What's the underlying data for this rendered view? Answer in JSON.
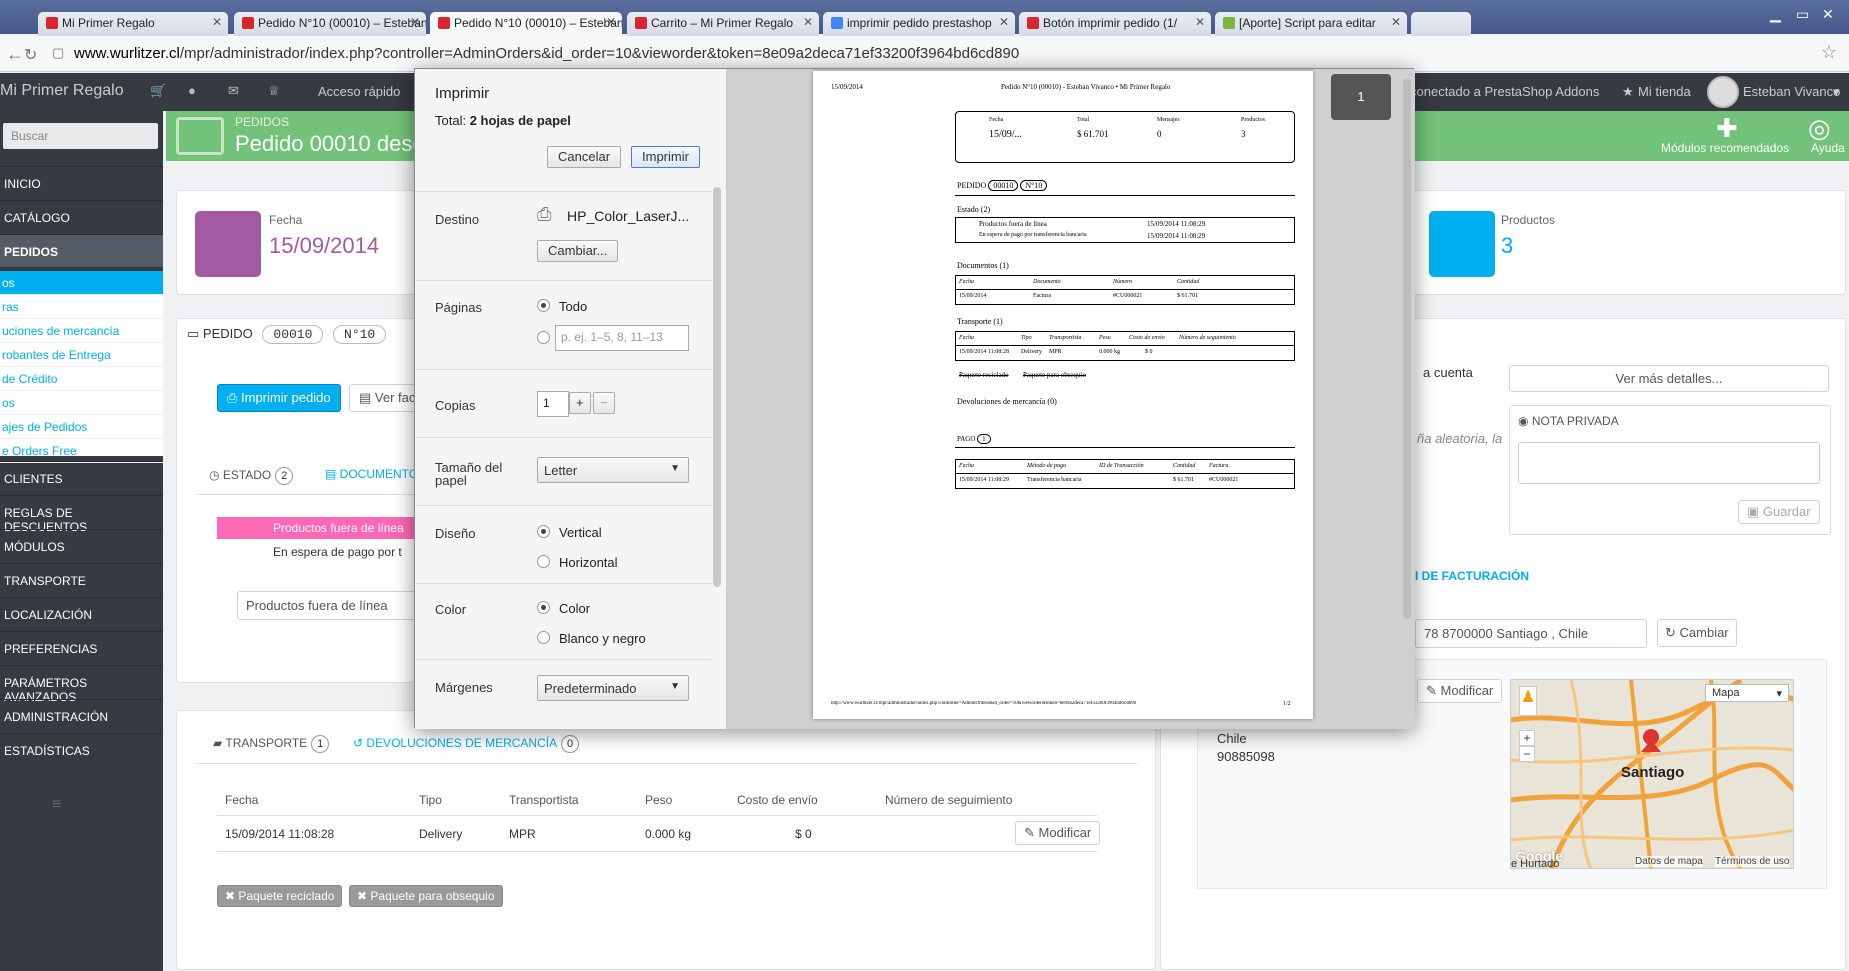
{
  "browser": {
    "tabs": [
      {
        "title": "Mi Primer Regalo"
      },
      {
        "title": "Pedido N°10 (00010) – Esteban"
      },
      {
        "title": "Pedido N°10 (00010) – Esteban"
      },
      {
        "title": "Carrito – Mi Primer Regalo"
      },
      {
        "title": "imprimir pedido prestashop"
      },
      {
        "title": "Botón imprimir pedido (1/"
      },
      {
        "title": "[Aporte] Script para editar"
      }
    ],
    "url_host": "www.wurlitzer.cl",
    "url_path": "/mpr/administrador/index.php?controller=AdminOrders&id_order=10&vieworder&token=8e09a2deca71ef33200f3964bd6cd890"
  },
  "topbar": {
    "brand": "Mi Primer Regalo",
    "quick_access": "Acceso rápido",
    "addons": "conectado a PrestaShop Addons",
    "shop": "Mi tienda",
    "user": "Esteban Vivanco"
  },
  "header": {
    "breadcrumb": "PEDIDOS",
    "title": "Pedido 00010 desde",
    "modules_btn": "Módulos recomendados",
    "help_btn": "Ayuda"
  },
  "sidebar": {
    "search_placeholder": "Buscar",
    "items": [
      "INICIO",
      "CATÁLOGO",
      "PEDIDOS",
      "CLIENTES",
      "REGLAS DE DESCUENTOS",
      "MÓDULOS",
      "TRANSPORTE",
      "LOCALIZACIÓN",
      "PREFERENCIAS",
      "PARÁMETROS AVANZADOS",
      "ADMINISTRACIÓN",
      "ESTADÍSTICAS"
    ],
    "submenu": [
      "os",
      "ras",
      "uciones de mercancía",
      "robantes de Entrega",
      "de Crédito",
      "os",
      "ajes de Pedidos",
      "e Orders Free"
    ]
  },
  "kpis": {
    "date_label": "Fecha",
    "date_value": "15/09/2014",
    "products_label": "Productos",
    "products_value": "3"
  },
  "order": {
    "label": "PEDIDO",
    "ref": "00010",
    "num": "N°10",
    "print_btn": "Imprimir pedido",
    "view_btn": "Ver fact",
    "tab_status": "ESTADO",
    "tab_status_count": "2",
    "tab_docs": "DOCUMENTOS",
    "status_rows": [
      "Productos fuera de línea",
      "En espera de pago por t"
    ],
    "status_select": "Productos fuera de línea"
  },
  "transport": {
    "tab": "TRANSPORTE",
    "tab_count": "1",
    "returns_tab": "DEVOLUCIONES DE MERCANCÍA",
    "returns_count": "0",
    "headers": [
      "Fecha",
      "Tipo",
      "Transportista",
      "Peso",
      "Costo de envío",
      "Número de seguimiento"
    ],
    "row": [
      "15/09/2014 11:08:28",
      "Delivery",
      "MPR",
      "0.000 kg",
      "$ 0"
    ],
    "edit_btn": "Modificar",
    "recycled_btn": "Paquete reciclado",
    "gift_btn": "Paquete para obsequio"
  },
  "customer": {
    "account_frag": "a cuenta",
    "random_frag": "ña aleatoria, la",
    "details_btn": "Ver más detalles...",
    "private_note": "NOTA PRIVADA",
    "save_btn": "Guardar",
    "billing_frag": "I DE FACTURACIÓN",
    "address_select": "78 8700000 Santiago , Chile",
    "change_btn": "Cambiar",
    "modify_btn": "Modificar",
    "country": "Chile",
    "phone": "90885098",
    "map_type": "Mapa",
    "map_city": "Santiago",
    "map_terms": "Datos de mapa",
    "map_terms2": "Términos de uso",
    "map_place": "e Hurtado",
    "map_google": "Google"
  },
  "print_dialog": {
    "title": "Imprimir",
    "total_label": "Total:",
    "total_value": "2 hojas de papel",
    "cancel_btn": "Cancelar",
    "print_btn": "Imprimir",
    "dest_label": "Destino",
    "printer": "HP_Color_LaserJ...",
    "change_btn": "Cambiar...",
    "pages_label": "Páginas",
    "pages_all": "Todo",
    "pages_placeholder": "p. ej. 1–5, 8, 11–13",
    "copies_label": "Copias",
    "copies_value": "1",
    "size_label": "Tamaño del papel",
    "size_value": "Letter",
    "layout_label": "Diseño",
    "layout_portrait": "Vertical",
    "layout_landscape": "Horizontal",
    "color_label": "Color",
    "color_color": "Color",
    "color_bw": "Blanco y negro",
    "margins_label": "Márgenes",
    "margins_value": "Predeterminado",
    "page_indicator": "1"
  },
  "preview": {
    "date": "15/09/2014",
    "head": "Pedido N°10 (00010) - Esteban Vivanco • Mi Primer Regalo",
    "kpi_labels": [
      "Fecha",
      "Total",
      "Mensajes",
      "Productos"
    ],
    "kpi_values": [
      "15/09/...",
      "$ 61.701",
      "0",
      "3"
    ],
    "order_label": "PEDIDO",
    "order_ref": "00010",
    "order_num": "N°10",
    "state_title": "Estado (2)",
    "state_rows": [
      [
        "Productos fuera de línea",
        "15/09/2014 11:08:29"
      ],
      [
        "En espera de pago por transferencia bancaria",
        "15/09/2014 11:08:29"
      ]
    ],
    "docs_title": "Documentos (1)",
    "docs_headers": [
      "Fecha",
      "Documento",
      "Número",
      "Cantidad"
    ],
    "docs_row": [
      "15/09/2014",
      "Factura",
      "#CU000021",
      "$ 61.701"
    ],
    "transport_title": "Transporte (1)",
    "transport_headers": [
      "Fecha",
      "Tipo",
      "Transportista",
      "Peso",
      "Costo de envío",
      "Número de seguimiento"
    ],
    "transport_row": [
      "15/09/2014 11:08:28",
      "Delivery",
      "MPR",
      "0.000 kg",
      "$ 0"
    ],
    "strike1": "Paquete reciclado",
    "strike2": "Paquete para obsequio",
    "returns_title": "Devoluciones de mercancía (0)",
    "payment_label": "PAGO",
    "payment_count": "1",
    "payment_headers": [
      "Fecha",
      "Método de pago",
      "ID de Transacción",
      "Cantidad",
      "Factura"
    ],
    "payment_row": [
      "15/09/2014 11:08:29",
      "Transferencia bancaria",
      "",
      "$ 61.701",
      "#CU000021"
    ],
    "footer_url": "http://www.wurlitzer.cl/mpr/administrador/index.php?controller=AdminOrders&id_order=10&vieworder&token=8e09a2deca71ef33200f3964bd6cd890",
    "footer_page": "1/2"
  },
  "colors": {
    "accent": "#00aff0",
    "green": "#72c279",
    "purple": "#a25aa3",
    "sidebar": "#363a41",
    "pink_status": "#ff69b4"
  }
}
